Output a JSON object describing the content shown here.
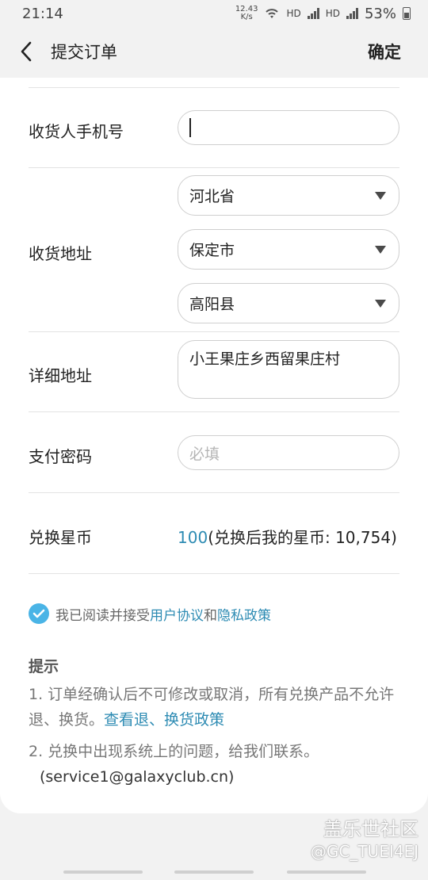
{
  "status": {
    "time": "21:14",
    "netspeed_top": "12.43",
    "netspeed_bottom": "K/s",
    "hd1": "HD",
    "hd2": "HD",
    "battery": "53%"
  },
  "appbar": {
    "title": "提交订单",
    "confirm": "确定"
  },
  "form": {
    "phone_label": "收货人手机号",
    "address_label": "收货地址",
    "province": "河北省",
    "city": "保定市",
    "county": "高阳县",
    "detail_label": "详细地址",
    "detail_value": "小王果庄乡西留果庄村",
    "password_label": "支付密码",
    "password_placeholder": "必填",
    "points_label": "兑换星币",
    "points_value": "100",
    "points_note": "(兑换后我的星币: 10,754)"
  },
  "agreement": {
    "prefix": "我已阅读并接受",
    "user_agreement": "用户协议",
    "and": "和",
    "privacy": "隐私政策"
  },
  "tips": {
    "title": "提示",
    "tip1_text": "1. 订单经确认后不可修改或取消，所有兑换产品不允许退、换货。",
    "tip1_link": "查看退、换货政策",
    "tip2_text": "2. 兑换中出现系统上的问题，给我们联系。",
    "tip2_email": "(service1@galaxyclub.cn)"
  },
  "watermark": {
    "line1": "盖乐世社区",
    "line2": "@GC_TUEI4EJ"
  }
}
